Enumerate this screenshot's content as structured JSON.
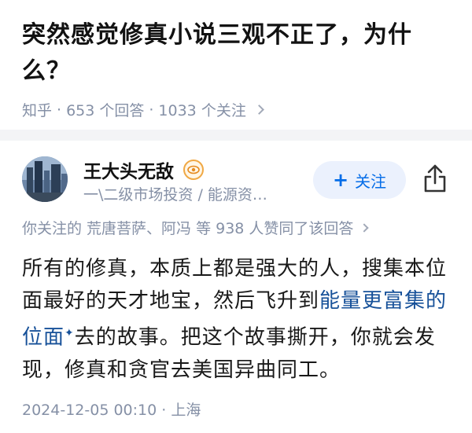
{
  "question": {
    "title": "突然感觉修真小说三观不正了，为什么？",
    "source": "知乎",
    "answers": "653 个回答",
    "followers": "1033 个关注"
  },
  "author": {
    "name": "王大头无敌",
    "description": "一\\二级市场投资 / 能源资…",
    "follow_label": "关注",
    "badge_color": "#f0a844"
  },
  "upvote": {
    "text": "你关注的 荒唐菩萨、阿冯 等 938 人赞同了该回答"
  },
  "content": {
    "part1": "所有的修真，本质上都是强大的人，搜集本位面最好的天才地宝，然后飞升到",
    "link": "能量更富集的位面",
    "spark": "✦",
    "part2": "去的故事。把这个故事撕开，你就会发现，修真和贪官去美国异曲同工。"
  },
  "footer": {
    "date": "2024-12-05 00:10",
    "location": "上海"
  },
  "colors": {
    "accent": "#056de8",
    "link": "#175199",
    "meta": "#8590a6"
  }
}
